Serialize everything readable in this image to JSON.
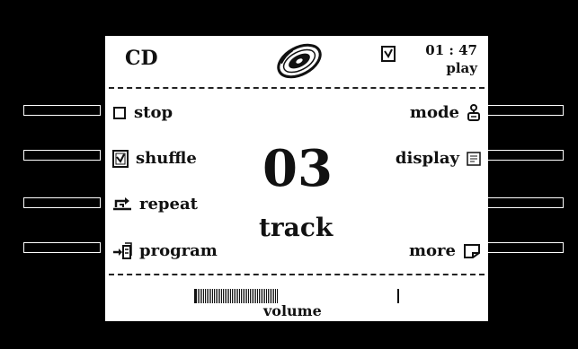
{
  "header": {
    "title": "CD",
    "disc_icon": "cd-disc-icon",
    "time": "01 : 47",
    "status": "play"
  },
  "menu": {
    "left": [
      {
        "label": "stop",
        "icon": "stop-icon"
      },
      {
        "label": "shuffle",
        "icon": "shuffle-icon"
      },
      {
        "label": "repeat",
        "icon": "repeat-icon"
      },
      {
        "label": "program",
        "icon": "program-icon"
      }
    ],
    "right": [
      {
        "label": "mode",
        "icon": "mode-icon"
      },
      {
        "label": "display",
        "icon": "display-icon"
      },
      {
        "label": "more",
        "icon": "more-icon"
      }
    ]
  },
  "track": {
    "number": "03",
    "label": "track"
  },
  "volume": {
    "label": "volume",
    "level": 0.4
  },
  "colors": {
    "background": "#000000",
    "screen": "#ffffff",
    "ink": "#111111"
  }
}
